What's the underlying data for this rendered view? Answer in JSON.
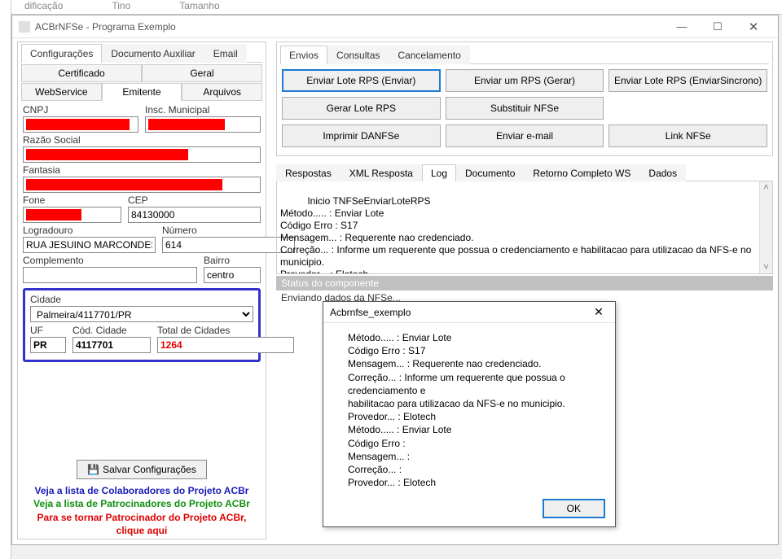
{
  "bg": {
    "col1": "dificação",
    "col2": "Tino",
    "col3": "Tamanho"
  },
  "window": {
    "title": "ACBrNFSe - Programa Exemplo"
  },
  "leftTabs": [
    "Configurações",
    "Documento Auxiliar",
    "Email"
  ],
  "subTabsTop": [
    "Certificado",
    "Geral"
  ],
  "subTabsBottom": [
    "WebService",
    "Emitente",
    "Arquivos"
  ],
  "form": {
    "cnpj_label": "CNPJ",
    "insc_label": "Insc. Municipal",
    "razao_label": "Razão Social",
    "fantasia_label": "Fantasia",
    "fone_label": "Fone",
    "cep_label": "CEP",
    "cep_value": "84130000",
    "logradouro_label": "Logradouro",
    "logradouro_value": "RUA JESUINO MARCONDES",
    "numero_label": "Número",
    "numero_value": "614",
    "complemento_label": "Complemento",
    "bairro_label": "Bairro",
    "bairro_value": "centro",
    "cidade_label": "Cidade",
    "cidade_value": "Palmeira/4117701/PR",
    "uf_label": "UF",
    "uf_value": "PR",
    "codcidade_label": "Cód. Cidade",
    "codcidade_value": "4117701",
    "totalcid_label": "Total de Cidades",
    "totalcid_value": "1264"
  },
  "save_label": "Salvar Configurações",
  "links": {
    "l1": "Veja a lista de Colaboradores do Projeto ACBr",
    "l2": "Veja a lista de Patrocinadores do Projeto ACBr",
    "l3a": "Para se tornar Patrocinador do Projeto ACBr,",
    "l3b": "clique aqui"
  },
  "rightTabs": [
    "Envios",
    "Consultas",
    "Cancelamento"
  ],
  "buttons": {
    "b1": "Enviar Lote RPS (Enviar)",
    "b2": "Enviar um RPS (Gerar)",
    "b3": "Enviar Lote RPS (EnviarSincrono)",
    "b4": "Gerar Lote RPS",
    "b5": "Substituir NFSe",
    "b6": "",
    "b7": "Imprimir DANFSe",
    "b8": "Enviar e-mail",
    "b9": "Link NFSe"
  },
  "logTabs": [
    "Respostas",
    "XML Resposta",
    "Log",
    "Documento",
    "Retorno Completo WS",
    "Dados"
  ],
  "log_text": "Inicio TNFSeEnviarLoteRPS\nMétodo..... : Enviar Lote\nCódigo Erro : S17\nMensagem... : Requerente nao credenciado.\nCorreção... : Informe um requerente que possua o credenciamento e habilitacao para utilizacao da NFS-e no municipio.\nProvedor... : Elotech\nMétodo..... : Enviar Lote",
  "status_label": "Status do componente",
  "status_text": "Enviando dados da NFSe...",
  "dialog": {
    "title": "Acbrnfse_exemplo",
    "body": "Método..... : Enviar Lote\nCódigo Erro : S17\nMensagem... : Requerente nao credenciado.\nCorreção... : Informe um requerente que possua o credenciamento e\nhabilitacao para utilizacao da NFS-e no municipio.\nProvedor... : Elotech\nMétodo..... : Enviar Lote\nCódigo Erro :\nMensagem... :\nCorreção... :\nProvedor... : Elotech",
    "ok": "OK"
  }
}
